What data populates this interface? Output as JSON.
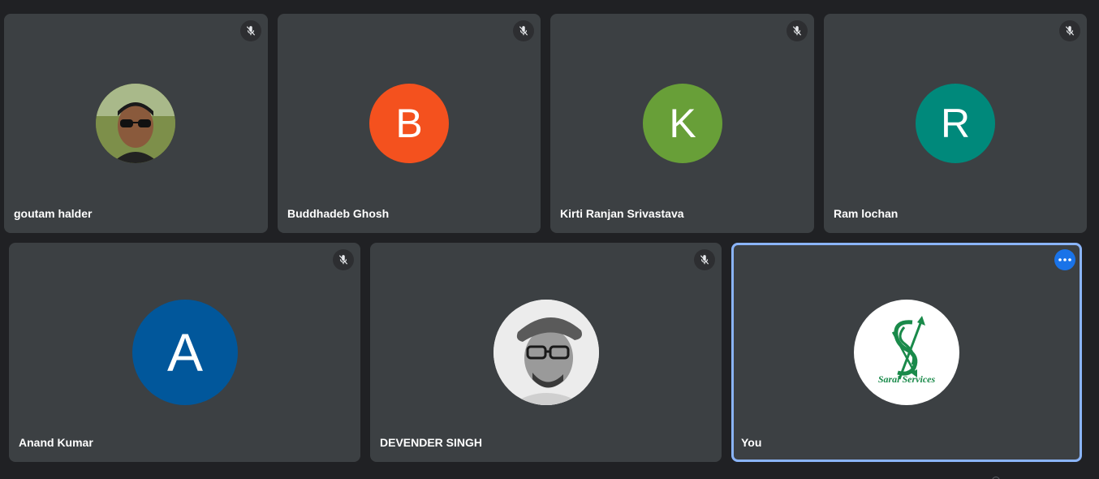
{
  "participants": [
    {
      "name": "goutam halder",
      "avatar": "photo",
      "muted": true
    },
    {
      "name": "Buddhadeb Ghosh",
      "initial": "B",
      "avatar_color": "#f4511e",
      "muted": true
    },
    {
      "name": "Kirti Ranjan Srivastava",
      "initial": "K",
      "avatar_color": "#689f38",
      "muted": true
    },
    {
      "name": "Ram lochan",
      "initial": "R",
      "avatar_color": "#00897b",
      "muted": true
    },
    {
      "name": "Anand Kumar",
      "initial": "A",
      "avatar_color": "#01579b",
      "muted": true
    },
    {
      "name": "DEVENDER SINGH",
      "avatar": "photo",
      "muted": true
    },
    {
      "name": "You",
      "avatar": "logo",
      "logo_text": "Saral Services",
      "muted": false,
      "is_self": true
    }
  ],
  "icons": {
    "muted": "mic-off-icon",
    "options": "more-options-icon"
  },
  "colors": {
    "background": "#202124",
    "tile": "#3c4043",
    "self_border": "#8ab4f8",
    "options_button": "#1a73e8"
  }
}
